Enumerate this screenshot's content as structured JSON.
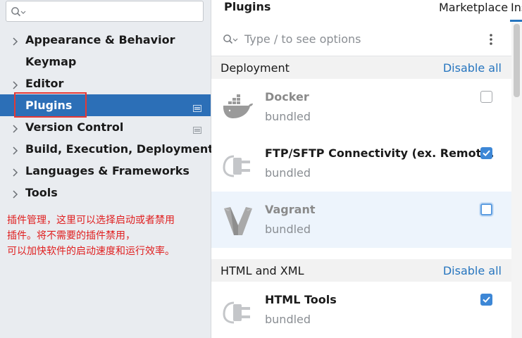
{
  "sidebar": {
    "search": {
      "placeholder": "",
      "value": ""
    },
    "items": [
      {
        "label": "Appearance & Behavior",
        "expandable": true,
        "badge": false
      },
      {
        "label": "Keymap",
        "expandable": false,
        "badge": false
      },
      {
        "label": "Editor",
        "expandable": true,
        "badge": false
      },
      {
        "label": "Plugins",
        "expandable": false,
        "badge": true,
        "selected": true
      },
      {
        "label": "Version Control",
        "expandable": true,
        "badge": true
      },
      {
        "label": "Build, Execution, Deployment",
        "expandable": true,
        "badge": false
      },
      {
        "label": "Languages & Frameworks",
        "expandable": true,
        "badge": false
      },
      {
        "label": "Tools",
        "expandable": true,
        "badge": false
      }
    ]
  },
  "annotation": {
    "lines": [
      "插件管理，这里可以选择启动或者禁用",
      "插件。将不需要的插件禁用，",
      "可以加快软件的启动速度和运行效率。"
    ],
    "color": "#e02020"
  },
  "main": {
    "title": "Plugins",
    "tabs": [
      "Marketplace",
      "Installed"
    ],
    "search_placeholder": "Type / to see options",
    "groups": [
      {
        "name": "Deployment",
        "action": "Disable all",
        "plugins": [
          {
            "name": "Docker",
            "meta": "bundled",
            "enabled": false,
            "icon": "docker-icon"
          },
          {
            "name": "FTP/SFTP Connectivity (ex. Remot...",
            "meta": "bundled",
            "enabled": true,
            "icon": "plug-icon"
          },
          {
            "name": "Vagrant",
            "meta": "bundled",
            "enabled": false,
            "icon": "vagrant-icon"
          }
        ]
      },
      {
        "name": "HTML and XML",
        "action": "Disable all",
        "plugins": [
          {
            "name": "HTML Tools",
            "meta": "bundled",
            "enabled": true,
            "icon": "plug-icon"
          }
        ]
      }
    ]
  },
  "colors": {
    "selection": "#2c6fb7",
    "accent": "#2675bf",
    "checkbox_on": "#3d87d6",
    "sidebar_bg": "#e9ecf0"
  }
}
